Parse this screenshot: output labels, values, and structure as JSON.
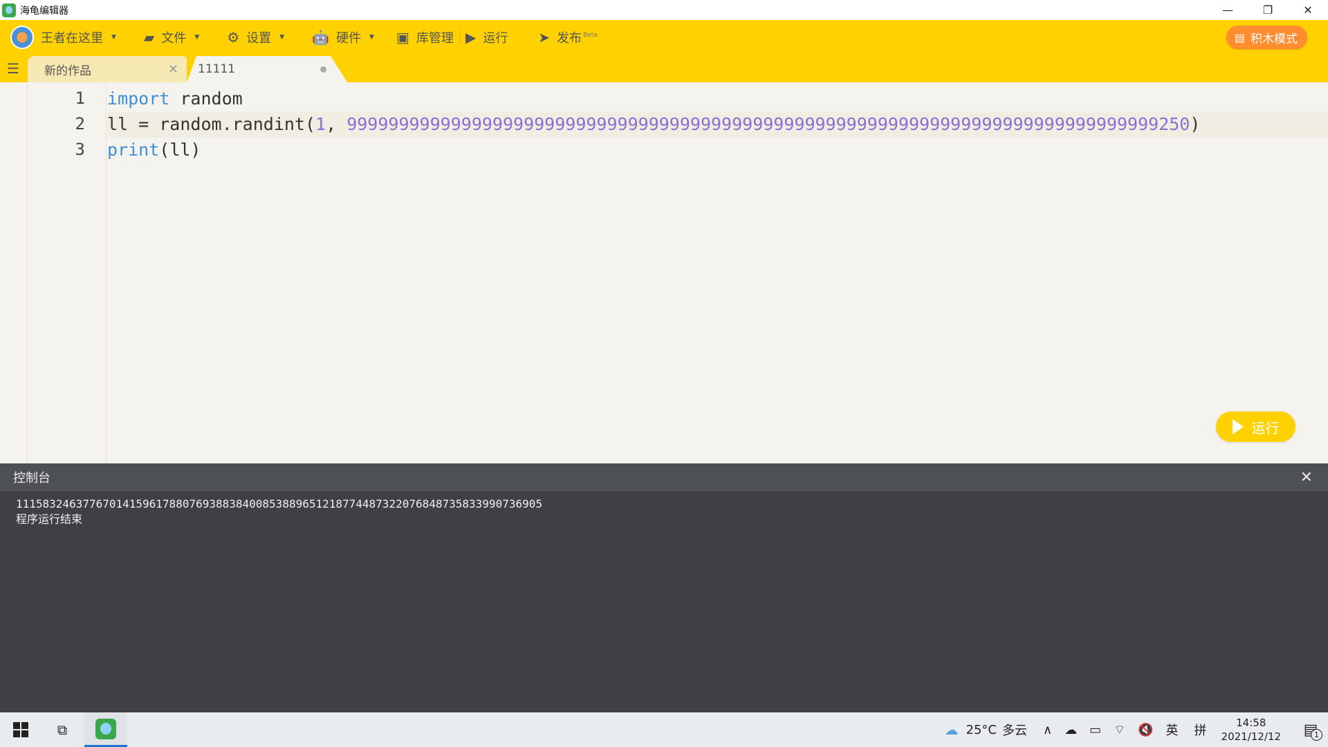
{
  "window": {
    "title": "海龟编辑器",
    "minimize_glyph": "—",
    "restore_glyph": "❐",
    "close_glyph": "✕"
  },
  "toolbar": {
    "user": "王者在这里",
    "file": "文件",
    "settings": "设置",
    "hardware": "硬件",
    "library": "库管理",
    "run": "运行",
    "publish": "发布",
    "publish_badge": "Beta",
    "blocks_mode": "积木模式"
  },
  "tabs": [
    {
      "label": "新的作品",
      "state": "inactive"
    },
    {
      "label": "11111",
      "state": "active-unsaved"
    }
  ],
  "editor": {
    "line_numbers": [
      "1",
      "2",
      "3"
    ],
    "lines": {
      "l1_kw": "import",
      "l1_rest": " random",
      "l2_a": "ll = random.randint(",
      "l2_n1": "1",
      "l2_b": ", ",
      "l2_n2": "999999999999999999999999999999999999999999999999999999999999999999999999999999250",
      "l2_c": ")",
      "l3_kw": "print",
      "l3_rest": "(ll)"
    },
    "run_button": "运行"
  },
  "console": {
    "title": "控制台",
    "output_line_1": "1115832463776701415961788076938838400853889651218774487322076848735833990736905",
    "output_line_2": "程序运行结束"
  },
  "taskbar": {
    "weather_temp": "25°C",
    "weather_desc": "多云",
    "ime_lang": "英",
    "ime_mode": "拼",
    "time": "14:58",
    "date": "2021/12/12",
    "notification_count": "1"
  },
  "colors": {
    "toolbar_bg": "#ffd100",
    "editor_bg": "#f5f3ee",
    "keyword": "#3f8fd6",
    "number": "#8c6fd0",
    "console_bg": "#3e4044",
    "blocks_button": "#ff8c2e"
  }
}
